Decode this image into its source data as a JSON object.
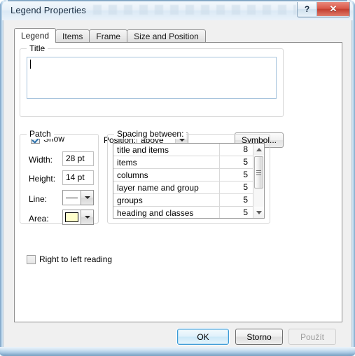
{
  "window": {
    "title": "Legend Properties",
    "help_button": "?",
    "close_button": "✕"
  },
  "tabs": [
    {
      "label": "Legend",
      "active": true
    },
    {
      "label": "Items",
      "active": false
    },
    {
      "label": "Frame",
      "active": false
    },
    {
      "label": "Size and Position",
      "active": false
    }
  ],
  "title_group": {
    "legend": "Title",
    "text_value": "",
    "show_checkbox": {
      "label": "Show",
      "checked": true
    },
    "position_label": "Position:",
    "position_value": "above",
    "symbol_button": "Symbol..."
  },
  "patch_group": {
    "legend": "Patch",
    "width_label": "Width:",
    "width_value": "28 pt",
    "height_label": "Height:",
    "height_value": "14 pt",
    "line_label": "Line:",
    "area_label": "Area:",
    "area_color": "#FFFFCC",
    "line_color": "#333333"
  },
  "spacing_group": {
    "legend": "Spacing between:",
    "rows": [
      {
        "name": "title and items",
        "value": "8"
      },
      {
        "name": "items",
        "value": "5"
      },
      {
        "name": "columns",
        "value": "5"
      },
      {
        "name": "layer name and group",
        "value": "5"
      },
      {
        "name": "groups",
        "value": "5"
      },
      {
        "name": "heading and classes",
        "value": "5"
      }
    ]
  },
  "rtl_checkbox": {
    "label": "Right to left reading",
    "checked": false
  },
  "footer": {
    "ok": "OK",
    "cancel": "Storno",
    "apply": "Použít"
  }
}
